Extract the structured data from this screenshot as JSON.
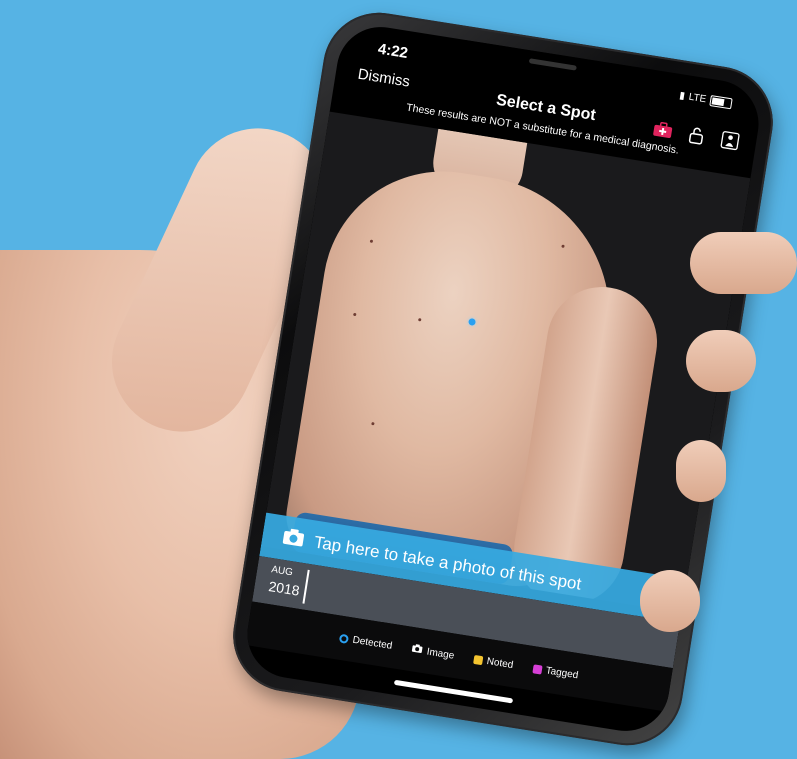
{
  "status": {
    "time": "4:22",
    "network": "LTE"
  },
  "nav": {
    "dismiss_label": "Dismiss",
    "title": "Select a Spot",
    "icons": [
      "first-aid-kit-icon",
      "lock-icon",
      "body-map-icon"
    ]
  },
  "disclaimer": "These results are NOT a substitute for a medical diagnosis.",
  "cta": {
    "label": "Tap here to take a photo of this spot",
    "icon": "camera-icon"
  },
  "timeline": {
    "month": "AUG",
    "year": "2018"
  },
  "legend": [
    {
      "label": "Detected",
      "color": "#2aa0f0",
      "icon": "circle-icon"
    },
    {
      "label": "Image",
      "color": "#ffffff",
      "icon": "camera-icon"
    },
    {
      "label": "Noted",
      "color": "#f4c430",
      "icon": "note-icon"
    },
    {
      "label": "Tagged",
      "color": "#d63fd6",
      "icon": "tag-icon"
    }
  ],
  "colors": {
    "background": "#56b3e4",
    "accent_red": "#e0245e",
    "cta_blue": "#37aae1"
  }
}
